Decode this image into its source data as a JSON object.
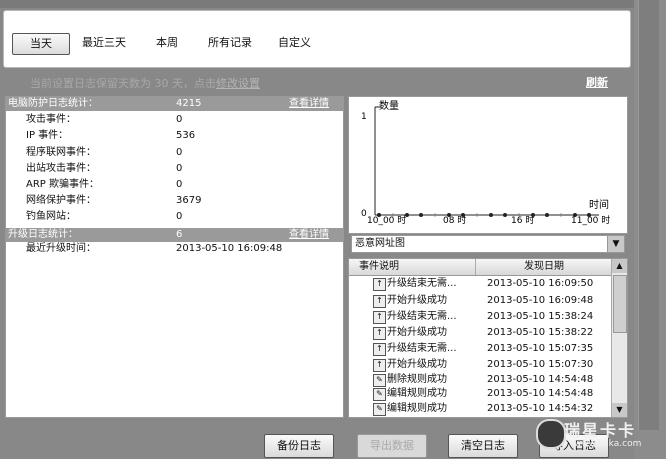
{
  "tabs": [
    {
      "label": "当天",
      "active": true
    },
    {
      "label": "最近三天",
      "active": false
    },
    {
      "label": "本周",
      "active": false
    },
    {
      "label": "所有记录",
      "active": false
    },
    {
      "label": "自定义",
      "active": false
    }
  ],
  "hint": {
    "prefix": "当前设置日志保留天数为 30 天，点击",
    "link": "修改设置"
  },
  "refresh_label": "刷新",
  "protection": {
    "title": "电脑防护日志统计：",
    "total": "4215",
    "detail_label": "查看详情",
    "rows": [
      {
        "label": "攻击事件：",
        "value": "0"
      },
      {
        "label": "IP 事件：",
        "value": "536"
      },
      {
        "label": "程序联网事件：",
        "value": "0"
      },
      {
        "label": "出站攻击事件：",
        "value": "0"
      },
      {
        "label": "ARP 欺骗事件：",
        "value": "0"
      },
      {
        "label": "网络保护事件：",
        "value": "3679"
      },
      {
        "label": "钓鱼网站：",
        "value": "0"
      }
    ]
  },
  "upgrade": {
    "title": "升级日志统计：",
    "total": "6",
    "detail_label": "查看详情",
    "last_label": "最近升级时间：",
    "last_value": "2013-05-10 16:09:48"
  },
  "chart_data": {
    "type": "line",
    "ylabel": "数量",
    "xlabel": "时间",
    "y_ticks": [
      "1",
      "0"
    ],
    "x_ticks": [
      "10_00 时",
      "08 时",
      "16 时",
      "11_00 时"
    ],
    "ylim": [
      0,
      1
    ],
    "points": [
      0,
      0,
      0,
      0,
      0,
      0,
      0,
      0,
      0,
      0,
      0,
      0,
      0,
      0,
      0,
      0
    ],
    "grid": false
  },
  "chart_select": {
    "value": "恶意网址图"
  },
  "log_table": {
    "headers": [
      "事件说明",
      "发现日期"
    ],
    "rows": [
      {
        "icon": "upgrade-icon",
        "event": "升级结束无需...",
        "date": "2013-05-10 16:09:50"
      },
      {
        "icon": "upgrade-icon",
        "event": "开始升级成功",
        "date": "2013-05-10 16:09:48"
      },
      {
        "icon": "upgrade-icon",
        "event": "升级结束无需...",
        "date": "2013-05-10 15:38:24"
      },
      {
        "icon": "upgrade-icon",
        "event": "开始升级成功",
        "date": "2013-05-10 15:38:22"
      },
      {
        "icon": "upgrade-icon",
        "event": "升级结束无需...",
        "date": "2013-05-10 15:07:35"
      },
      {
        "icon": "upgrade-icon",
        "event": "开始升级成功",
        "date": "2013-05-10 15:07:30"
      },
      {
        "icon": "rule-icon",
        "event": "删除规则成功",
        "date": "2013-05-10 14:54:48"
      },
      {
        "icon": "rule-icon",
        "event": "编辑规则成功",
        "date": "2013-05-10 14:54:48"
      },
      {
        "icon": "rule-icon",
        "event": "编辑规则成功",
        "date": "2013-05-10 14:54:32"
      }
    ]
  },
  "buttons": {
    "backup": "备份日志",
    "export": "导出数据",
    "clear": "清空日志",
    "import": "导入日志"
  },
  "watermark": {
    "big": "瑞星卡卡",
    "small": "www.kaka.com"
  }
}
